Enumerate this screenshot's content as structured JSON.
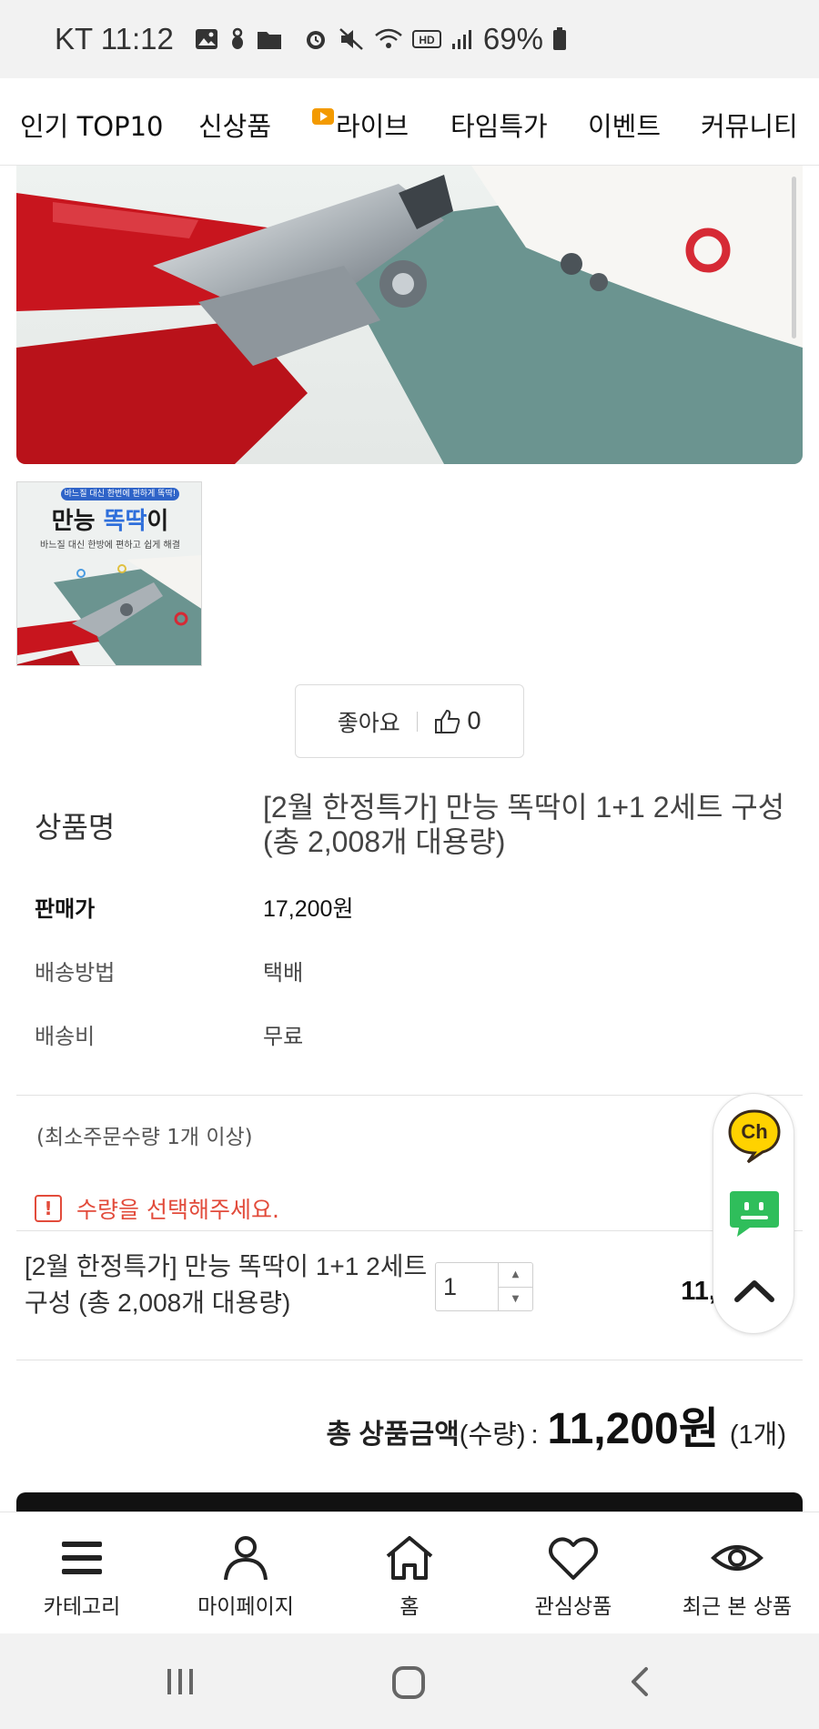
{
  "status_bar": {
    "carrier_time": "KT 11:12",
    "battery": "69%"
  },
  "top_nav": {
    "items": [
      "인기 TOP10",
      "신상품",
      "라이브",
      "타임특가",
      "이벤트",
      "커뮤니티"
    ]
  },
  "thumbnail": {
    "banner": "바느질 대신 한번에 편하게 똑딱!",
    "title_main": "만능 ",
    "title_accent": "똑딱",
    "title_end": "이",
    "subtitle": "바느질 대신 한방에 편하고 쉽게 해결"
  },
  "like": {
    "label": "좋아요",
    "count": "0"
  },
  "product": {
    "name_label": "상품명",
    "name": "[2월 한정특가] 만능 똑딱이 1+1 2세트 구성 (총 2,008개 대용량)",
    "price_label": "판매가",
    "price": "17,200원",
    "shipping_label": "배송방법",
    "shipping": "택배",
    "fee_label": "배송비",
    "fee": "무료"
  },
  "order": {
    "min_order": "(최소주문수량 1개 이상)",
    "warning": "수량을 선택해주세요.",
    "option_name": "[2월 한정특가] 만능 똑딱이 1+1 2세트 구성 (총 2,008개 대용량)",
    "quantity": "1",
    "option_price": "11,200원"
  },
  "total": {
    "label": "총 상품금액",
    "paren": "(수량)",
    "colon": ":",
    "amount": "11,200원",
    "count": "(1개)"
  },
  "floating": {
    "channel_label": "Ch"
  },
  "bottom_nav": {
    "items": [
      "카테고리",
      "마이페이지",
      "홈",
      "관심상품",
      "최근 본 상품"
    ]
  },
  "colors": {
    "accent_red": "#e24b3b",
    "kakao_yellow": "#ffd200",
    "talk_green": "#2fbe5b",
    "live_orange": "#f39a00"
  }
}
